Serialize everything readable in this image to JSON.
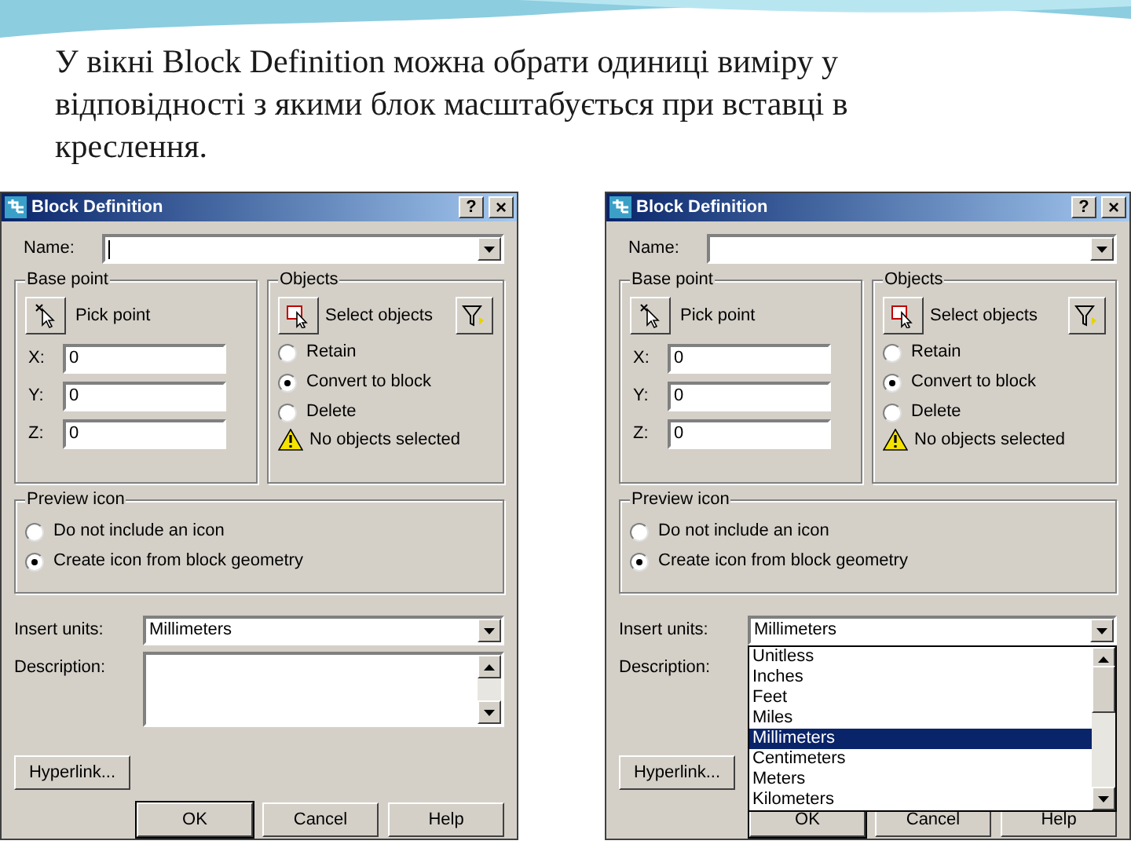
{
  "slide_title": "У вікні Block Definition можна обрати одиниці виміру у відповідності з якими блок масштабується при вставці в креслення.",
  "dialogs": [
    {
      "title": "Block Definition",
      "help_button": "?",
      "close_button": "×",
      "name": {
        "label": "Name:",
        "focused": true
      },
      "base_point": {
        "label": "Base point",
        "pick_button": "Pick point",
        "fields": [
          {
            "label": "X:",
            "value": "0"
          },
          {
            "label": "Y:",
            "value": "0"
          },
          {
            "label": "Z:",
            "value": "0"
          }
        ]
      },
      "objects": {
        "label": "Objects",
        "select_button": "Select objects",
        "options": [
          {
            "label": "Retain",
            "selected": false
          },
          {
            "label": "Convert to block",
            "selected": true
          },
          {
            "label": "Delete",
            "selected": false
          }
        ],
        "warning": "No objects selected"
      },
      "preview_icon": {
        "label": "Preview icon",
        "options": [
          {
            "label": "Do not include an icon",
            "selected": false
          },
          {
            "label": "Create icon from block geometry",
            "selected": true
          }
        ]
      },
      "insert_units": {
        "label": "Insert units:",
        "value": "Millimeters"
      },
      "description": {
        "label": "Description:"
      },
      "hyperlink_button": "Hyperlink...",
      "buttons": [
        {
          "label": "OK",
          "default": true
        },
        {
          "label": "Cancel",
          "default": false
        },
        {
          "label": "Help",
          "default": false
        }
      ]
    },
    {
      "title": "Block Definition",
      "help_button": "?",
      "close_button": "×",
      "name": {
        "label": "Name:",
        "focused": false
      },
      "base_point": {
        "label": "Base point",
        "pick_button": "Pick point",
        "fields": [
          {
            "label": "X:",
            "value": "0"
          },
          {
            "label": "Y:",
            "value": "0"
          },
          {
            "label": "Z:",
            "value": "0"
          }
        ]
      },
      "objects": {
        "label": "Objects",
        "select_button": "Select objects",
        "options": [
          {
            "label": "Retain",
            "selected": false
          },
          {
            "label": "Convert to block",
            "selected": true
          },
          {
            "label": "Delete",
            "selected": false
          }
        ],
        "warning": "No objects selected"
      },
      "preview_icon": {
        "label": "Preview icon",
        "options": [
          {
            "label": "Do not include an icon",
            "selected": false
          },
          {
            "label": "Create icon from block geometry",
            "selected": true
          }
        ]
      },
      "insert_units": {
        "label": "Insert units:",
        "value": "Millimeters",
        "dropdown": [
          {
            "label": "Unitless",
            "selected": false
          },
          {
            "label": "Inches",
            "selected": false
          },
          {
            "label": "Feet",
            "selected": false
          },
          {
            "label": "Miles",
            "selected": false
          },
          {
            "label": "Millimeters",
            "selected": true
          },
          {
            "label": "Centimeters",
            "selected": false
          },
          {
            "label": "Meters",
            "selected": false
          },
          {
            "label": "Kilometers",
            "selected": false
          }
        ]
      },
      "description": {
        "label": "Description:"
      },
      "hyperlink_button": "Hyperlink...",
      "buttons": [
        {
          "label": "OK",
          "default": true
        },
        {
          "label": "Cancel",
          "default": false
        },
        {
          "label": "Help",
          "default": false
        }
      ]
    }
  ]
}
